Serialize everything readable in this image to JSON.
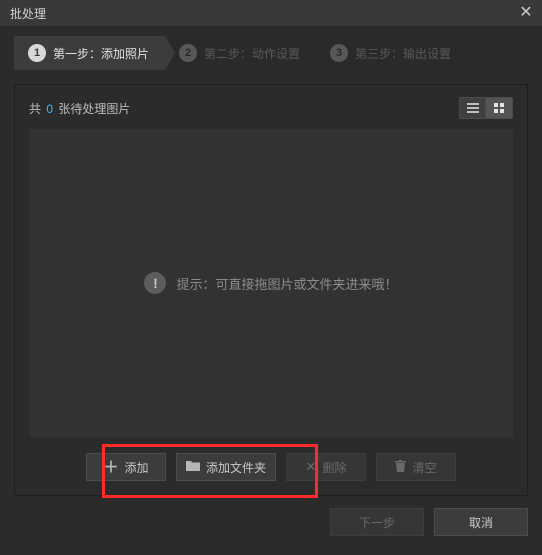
{
  "window": {
    "title": "批处理"
  },
  "steps": [
    {
      "num": "1",
      "label": "第一步：添加照片",
      "active": true
    },
    {
      "num": "2",
      "label": "第二步：动作设置",
      "active": false
    },
    {
      "num": "3",
      "label": "第三步：输出设置",
      "active": false
    }
  ],
  "counter": {
    "prefix": "共 ",
    "value": "0",
    "suffix": " 张待处理图片"
  },
  "view_mode": "grid",
  "drop_hint": {
    "mark": "!",
    "text": "提示：可直接拖图片或文件夹进来哦！"
  },
  "buttons": {
    "add": "添加",
    "add_folder": "添加文件夹",
    "delete": "删除",
    "clear": "清空",
    "next": "下一步",
    "cancel": "取消"
  },
  "icons": {
    "close": "✕",
    "plus": "＋"
  }
}
